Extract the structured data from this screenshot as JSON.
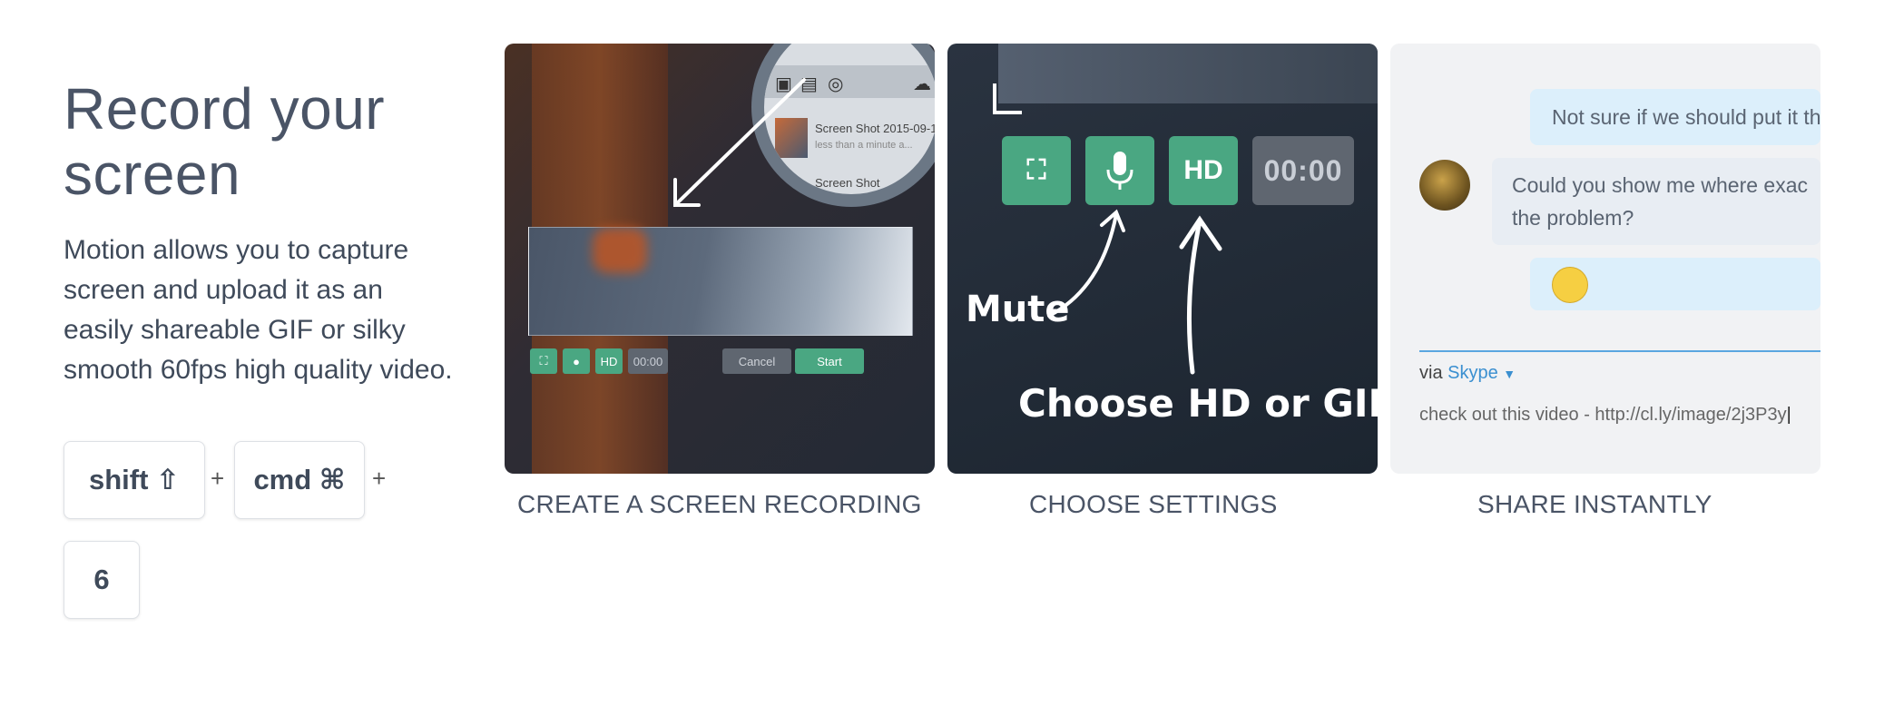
{
  "hero": {
    "title_line1": "Record your",
    "title_line2": "screen",
    "description": "Motion allows you to capture screen and upload it as an easily shareable GIF or silky smooth 60fps high quality video."
  },
  "shortcut": {
    "key1": "shift ⇧",
    "key2": "cmd ⌘",
    "key3": "6",
    "plus": "+"
  },
  "steps": [
    {
      "caption": "CREATE A SCREEN RECORDING",
      "preview": {
        "file_title": "Screen Shot 2015-09-1",
        "file_subtitle": "less than a minute a...",
        "file2_title": "Screen Shot",
        "hd_label": "HD",
        "timer": "00:00",
        "cancel_label": "Cancel",
        "start_label": "Start"
      }
    },
    {
      "caption": "CHOOSE SETTINGS",
      "preview": {
        "hd_label": "HD",
        "timer": "00:00",
        "mute_annotation": "Mute",
        "choose_annotation": "Choose HD or GIF"
      }
    },
    {
      "caption": "SHARE INSTANTLY",
      "preview": {
        "message1": "Not sure if we should put it th",
        "message2_line1": "Could you show me where exac",
        "message2_line2": "the problem?",
        "via_label": "via",
        "via_service": "Skype",
        "compose_text": "check out this video - http://cl.ly/image/2j3P3y"
      }
    }
  ],
  "colors": {
    "accent_green": "#4aa782",
    "link_blue": "#3a8fd0",
    "bubble_blue": "#dceffb"
  }
}
